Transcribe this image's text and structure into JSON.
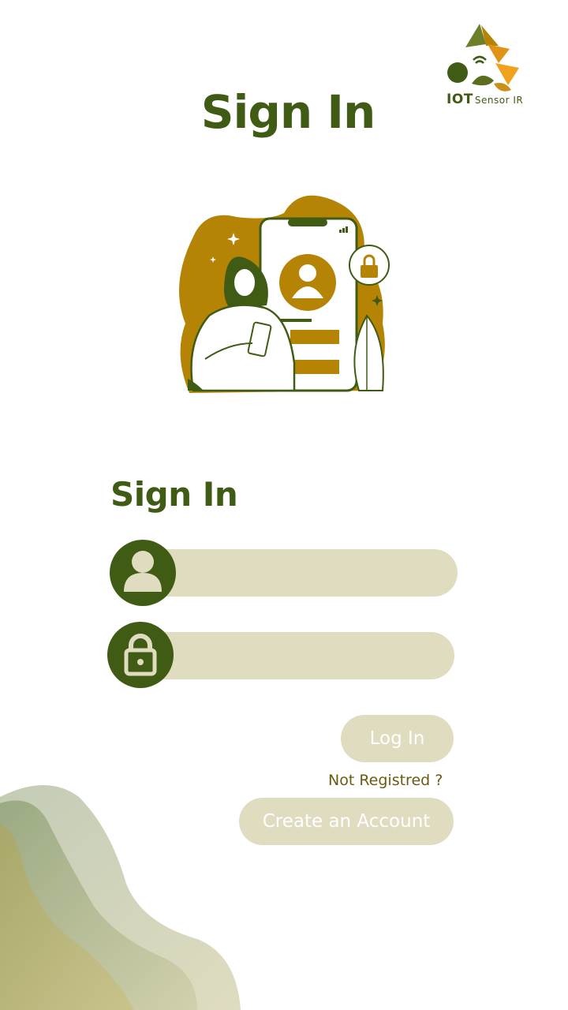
{
  "logo": {
    "brand": "IOT",
    "sub": "Sensor IR"
  },
  "header": {
    "title": "Sign In"
  },
  "form": {
    "title": "Sign In",
    "username_value": "",
    "password_value": "",
    "login_label": "Log In",
    "not_registered_text": "Not Registred ?",
    "create_account_label": "Create an Account"
  },
  "icons": {
    "username": "user-icon",
    "password": "lock-icon"
  },
  "colors": {
    "primary": "#3f5b14",
    "accent": "#b58405",
    "field_bg": "#dfdcc0",
    "link": "#6b5a12"
  }
}
